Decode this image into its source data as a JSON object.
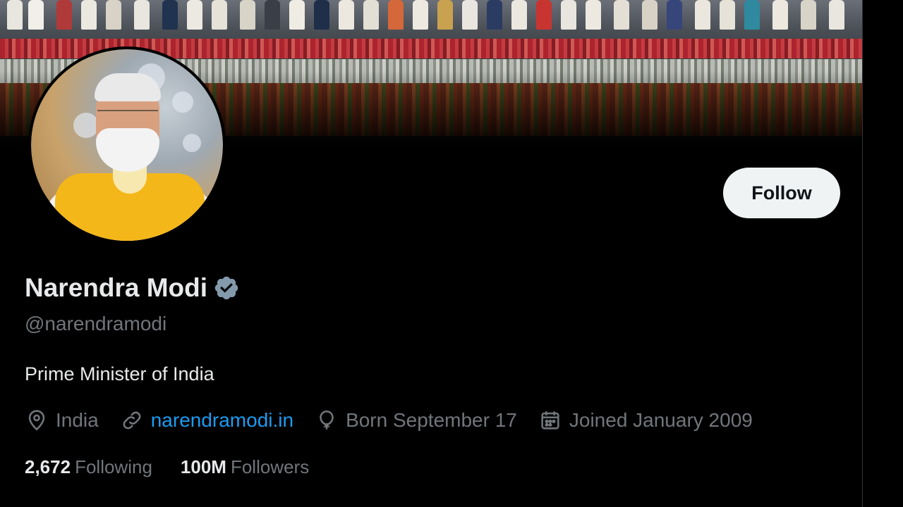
{
  "profile": {
    "display_name": "Narendra Modi",
    "handle": "@narendramodi",
    "bio": "Prime Minister of India",
    "verified_icon": "verified-badge-icon",
    "follow_label": "Follow"
  },
  "meta": {
    "location": "India",
    "website": "narendramodi.in",
    "birthday": "Born September 17",
    "joined": "Joined January 2009"
  },
  "stats": {
    "following_count": "2,672",
    "following_label": "Following",
    "followers_count": "100M",
    "followers_label": "Followers"
  },
  "colors": {
    "background": "#000000",
    "accent_link": "#1d9bf0",
    "muted_text": "#71767b",
    "verified_badge": "#829aab",
    "follow_button_bg": "#eff3f4"
  }
}
